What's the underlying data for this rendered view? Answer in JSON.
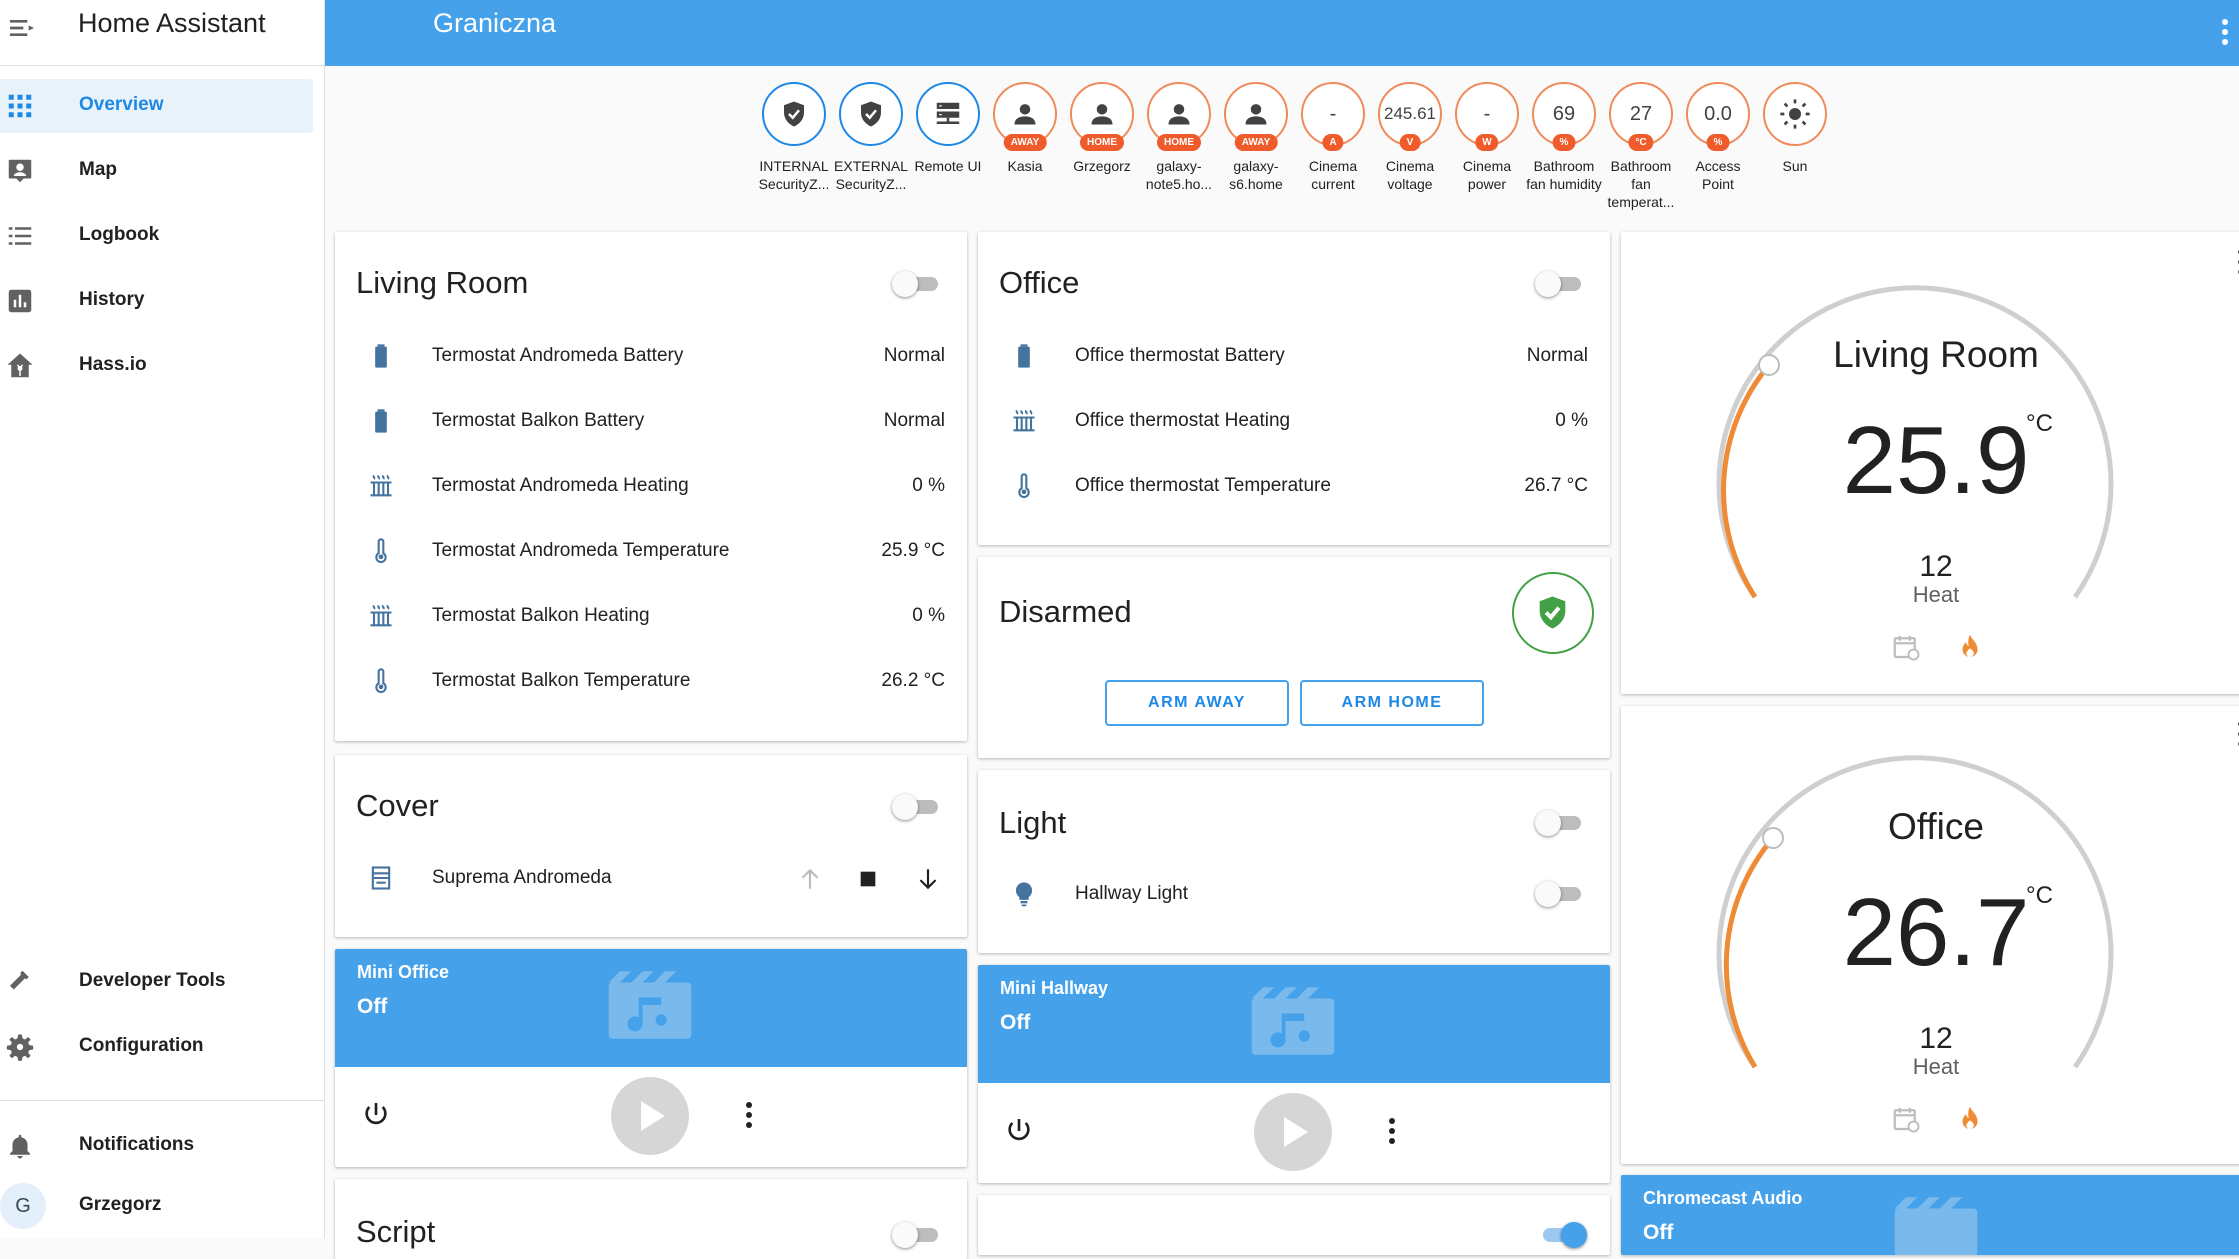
{
  "app": {
    "title": "Home Assistant"
  },
  "sidebar": {
    "items": [
      {
        "label": "Overview",
        "icon": "grid-icon"
      },
      {
        "label": "Map",
        "icon": "map-person-icon"
      },
      {
        "label": "Logbook",
        "icon": "list-icon"
      },
      {
        "label": "History",
        "icon": "chart-icon"
      },
      {
        "label": "Hass.io",
        "icon": "hassio-icon"
      }
    ],
    "bottom": [
      {
        "label": "Developer Tools",
        "icon": "hammer-icon"
      },
      {
        "label": "Configuration",
        "icon": "gear-icon"
      }
    ],
    "notifications": "Notifications",
    "user": {
      "initial": "G",
      "name": "Grzegorz"
    }
  },
  "header": {
    "title": "Graniczna"
  },
  "badges": [
    {
      "value": "",
      "tag": "",
      "label": "INTERNAL SecurityZ...",
      "icon": "shield-check-icon"
    },
    {
      "value": "",
      "tag": "",
      "label": "EXTERNAL SecurityZ...",
      "icon": "shield-check-icon"
    },
    {
      "value": "",
      "tag": "",
      "label": "Remote UI",
      "icon": "server-icon"
    },
    {
      "value": "",
      "tag": "AWAY",
      "label": "Kasia",
      "icon": "person-icon"
    },
    {
      "value": "",
      "tag": "HOME",
      "label": "Grzegorz",
      "icon": "person-icon"
    },
    {
      "value": "",
      "tag": "HOME",
      "label": "galaxy-note5.ho...",
      "icon": "person-icon"
    },
    {
      "value": "",
      "tag": "AWAY",
      "label": "galaxy-s6.home",
      "icon": "person-icon"
    },
    {
      "value": "-",
      "tag": "A",
      "label": "Cinema current",
      "icon": ""
    },
    {
      "value": "245.61",
      "tag": "V",
      "label": "Cinema voltage",
      "icon": ""
    },
    {
      "value": "-",
      "tag": "W",
      "label": "Cinema power",
      "icon": ""
    },
    {
      "value": "69",
      "tag": "%",
      "label": "Bathroom fan humidity",
      "icon": ""
    },
    {
      "value": "27",
      "tag": "°C",
      "label": "Bathroom fan temperat...",
      "icon": ""
    },
    {
      "value": "0.0",
      "tag": "%",
      "label": "Access Point",
      "icon": ""
    },
    {
      "value": "",
      "tag": "",
      "label": "Sun",
      "icon": "sun-icon"
    }
  ],
  "living_room": {
    "title": "Living Room",
    "rows": [
      {
        "name": "Termostat Andromeda Battery",
        "value": "Normal",
        "icon": "battery-icon"
      },
      {
        "name": "Termostat Balkon Battery",
        "value": "Normal",
        "icon": "battery-icon"
      },
      {
        "name": "Termostat Andromeda Heating",
        "value": "0 %",
        "icon": "radiator-icon"
      },
      {
        "name": "Termostat Andromeda Temperature",
        "value": "25.9 °C",
        "icon": "thermometer-icon"
      },
      {
        "name": "Termostat Balkon Heating",
        "value": "0 %",
        "icon": "radiator-icon"
      },
      {
        "name": "Termostat Balkon Temperature",
        "value": "26.2 °C",
        "icon": "thermometer-icon"
      }
    ]
  },
  "office": {
    "title": "Office",
    "rows": [
      {
        "name": "Office thermostat Battery",
        "value": "Normal",
        "icon": "battery-icon"
      },
      {
        "name": "Office thermostat Heating",
        "value": "0 %",
        "icon": "radiator-icon"
      },
      {
        "name": "Office thermostat Temperature",
        "value": "26.7 °C",
        "icon": "thermometer-icon"
      }
    ]
  },
  "alarm": {
    "state": "Disarmed",
    "arm_away": "ARM AWAY",
    "arm_home": "ARM HOME"
  },
  "cover": {
    "title": "Cover",
    "item": "Suprema Andromeda"
  },
  "light": {
    "title": "Light",
    "item": "Hallway Light"
  },
  "media": [
    {
      "name": "Mini Office",
      "state": "Off"
    },
    {
      "name": "Mini Hallway",
      "state": "Off"
    },
    {
      "name": "Chromecast Audio",
      "state": "Off"
    }
  ],
  "script": {
    "title": "Script"
  },
  "thermostats": [
    {
      "name": "Living Room",
      "temp": "25.9",
      "unit": "°C",
      "setpoint": "12",
      "mode": "Heat"
    },
    {
      "name": "Office",
      "temp": "26.7",
      "unit": "°C",
      "setpoint": "12",
      "mode": "Heat"
    }
  ],
  "colors": {
    "primary": "#44a1ea",
    "accent": "#ef8a5a",
    "badge_tag": "#ef5b2b",
    "alarm_green": "#43a047",
    "icon": "#44739e"
  }
}
